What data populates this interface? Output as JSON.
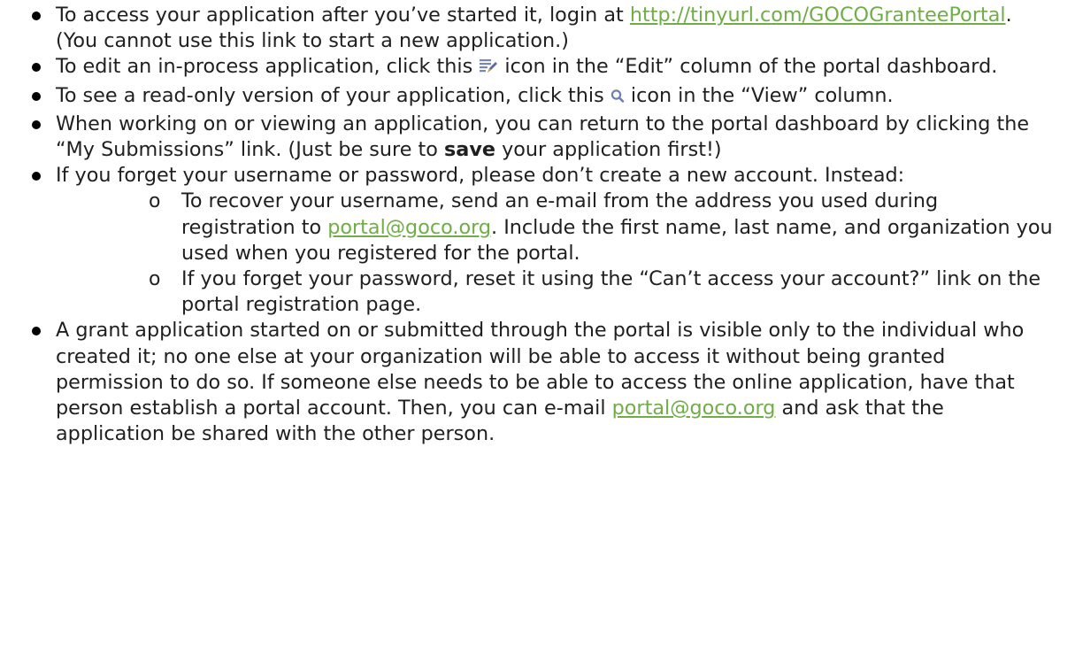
{
  "bullets": [
    {
      "pre": "To access your application after you’ve started it, login at ",
      "link": "http://tinyurl.com/GOCOGranteePortal",
      "post": ". (You cannot use this link to start a new application.)"
    },
    {
      "pre": "To edit an in-process application, click this ",
      "icon": "edit-icon",
      "post": " icon in the “Edit” column of the portal dashboard."
    },
    {
      "pre": "To see a read-only version of your application, click this ",
      "icon": "magnifier-icon",
      "post": "  icon in the “View” column."
    },
    {
      "pre": "When working on or viewing an application, you can return to the portal dashboard by clicking the “My Submissions” link. (Just be sure to ",
      "bold": "save",
      "post": " your application first!)"
    },
    {
      "text": "If you forget your username or password, please don’t create a new account. Instead:"
    },
    {
      "pre": "A grant application started on or submitted through the portal is visible only to the individual who created it; no one else at your organization will be able to access it without being granted permission to do so. If someone else needs to be able to access the online application, have that person establish a portal account. Then, you can e-mail ",
      "link": "portal@goco.org",
      "post": " and ask that the application be shared with the other person."
    }
  ],
  "sub_bullet_marker": "o",
  "sub_bullets": [
    {
      "pre": "To recover your username, send an e-mail from the address you used during registration to ",
      "link": "portal@goco.org",
      "post": ". Include the first name, last name, and organization you used when you registered for the portal."
    },
    {
      "text": "If you forget your password, reset it using the “Can’t access your account?” link on the portal registration page."
    }
  ],
  "colors": {
    "link": "#70ad47",
    "text": "#1f1f1f",
    "edit_icon": "#7a86b8",
    "magnifier_icon": "#6f7fae"
  }
}
